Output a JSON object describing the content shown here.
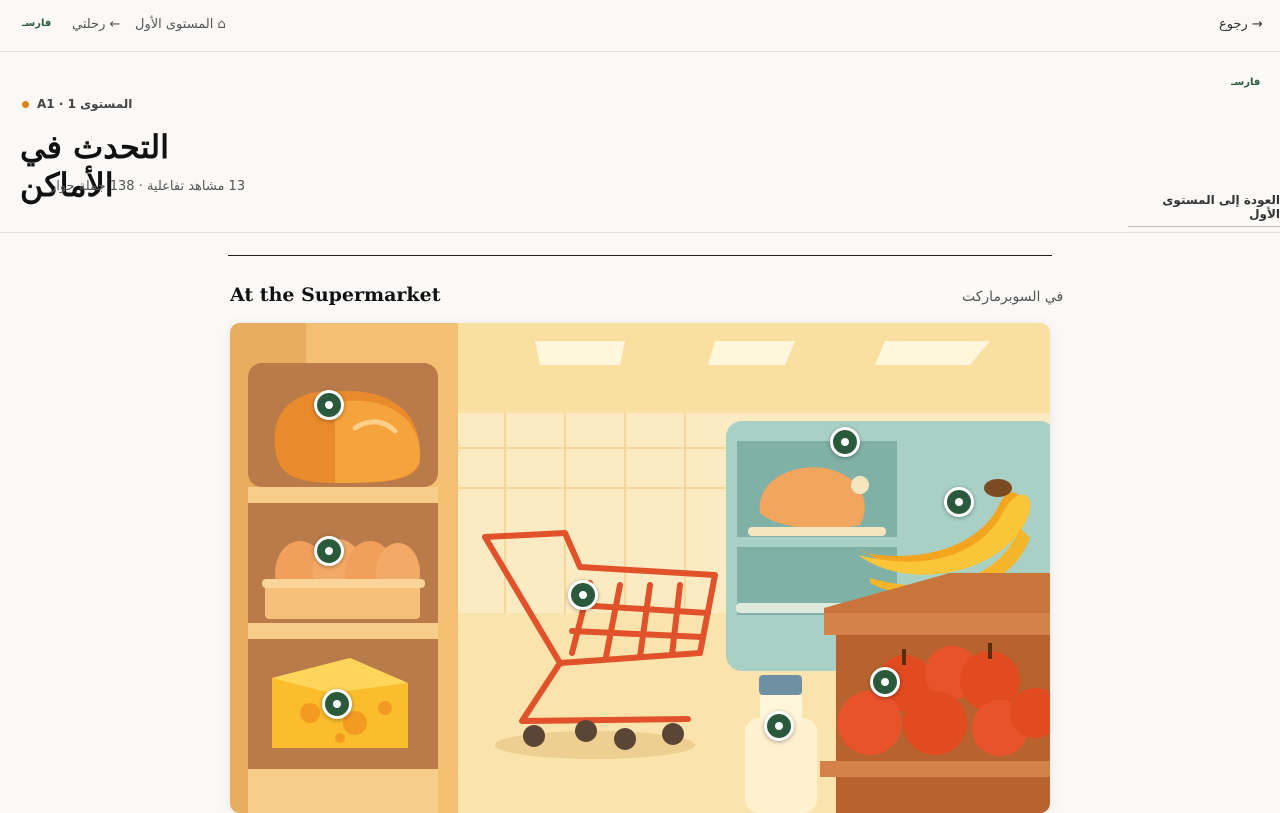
{
  "nav": {
    "back_label": "رجوع →",
    "logo": "فارسـ",
    "journey_label": "رحلتي ←",
    "level_label": "المستوى الأول ⌂"
  },
  "header": {
    "logo": "فارسـ",
    "level_tag": "A1 · المستوى 1",
    "title": "التحدث في الأماكن",
    "subtitle": "13 مشاهد تفاعلية · 138 جملة حوار",
    "return_label": "العودة إلى المستوى الأول"
  },
  "scene": {
    "title_en": "At the Supermarket",
    "title_ar": "في السوبرماركت",
    "illustration": "supermarket-scene",
    "hotspot_color": "#2a5a3b",
    "level_dot_color": "#d9840f"
  }
}
